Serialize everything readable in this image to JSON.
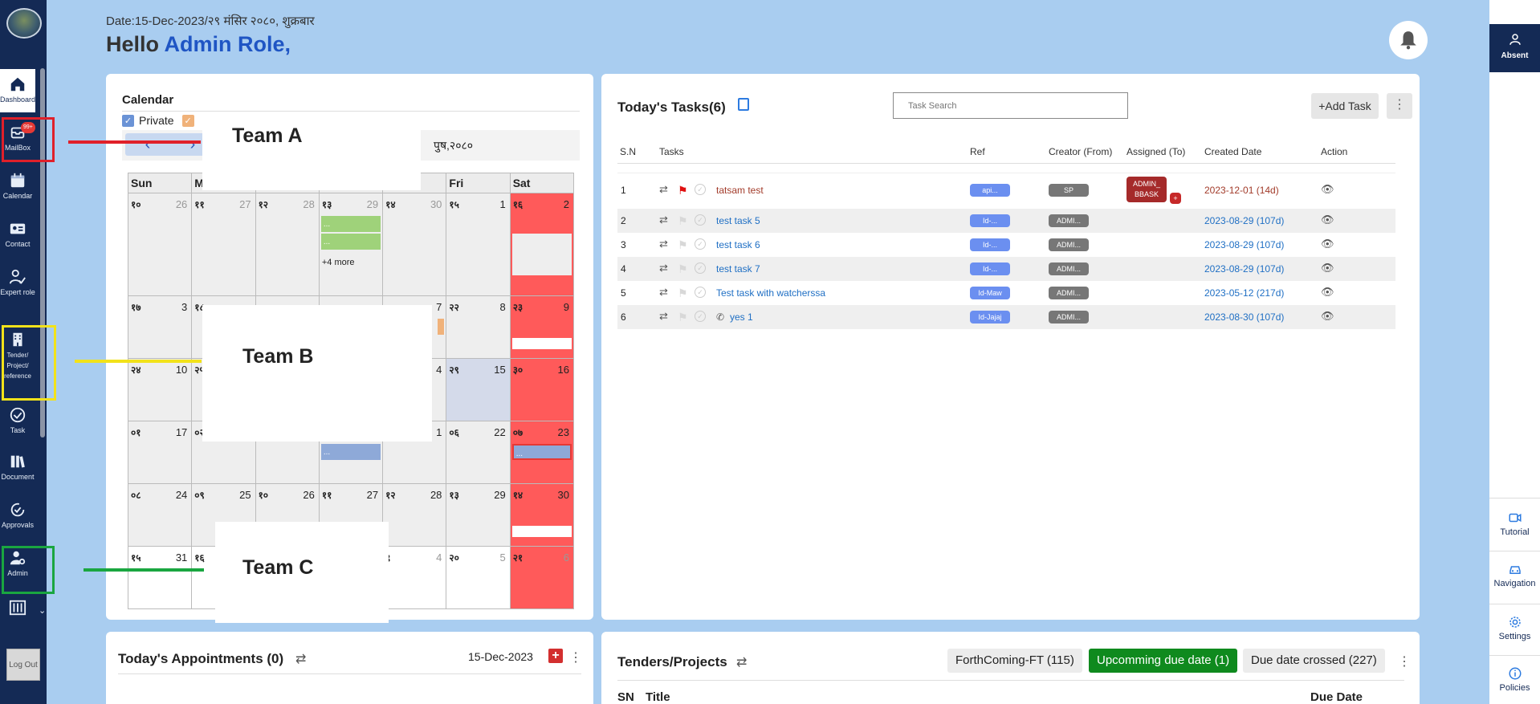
{
  "sidebar": {
    "items": [
      {
        "label": "Dashboard",
        "icon": "home-icon"
      },
      {
        "label": "MailBox",
        "icon": "mailbox-icon",
        "badge": "99+"
      },
      {
        "label": "Calendar",
        "icon": "calendar-icon"
      },
      {
        "label": "Contact",
        "icon": "contact-icon"
      },
      {
        "label": "Expert role",
        "icon": "expert-icon"
      },
      {
        "label": "Tender/ Project/ reference",
        "icon": "building-icon"
      },
      {
        "label": "Task",
        "icon": "check-icon"
      },
      {
        "label": "Document",
        "icon": "document-icon"
      },
      {
        "label": "Approvals",
        "icon": "approval-icon"
      },
      {
        "label": "Admin",
        "icon": "admin-icon"
      }
    ],
    "logout": "Log Out"
  },
  "header": {
    "date": "Date:15-Dec-2023/२९ मंसिर २०८०, शुक्रबार",
    "greeting_prefix": "Hello ",
    "greeting_name": "Admin Role,"
  },
  "teams": [
    "Team A",
    "Team B",
    "Team C"
  ],
  "team_colors": {
    "a": "#e0202a",
    "b": "#f2e21a",
    "c": "#1aa640"
  },
  "calendar": {
    "title": "Calendar",
    "legend_private": "Private",
    "month_label": "पुष,२०८०",
    "days": [
      "Sun",
      "M",
      "",
      "",
      "",
      "Fri",
      "Sat"
    ],
    "more": "+4 more",
    "weeks": [
      [
        {
          "n": "१०",
          "g": "26",
          "m": true
        },
        {
          "n": "११",
          "g": "27",
          "m": true
        },
        {
          "n": "१२",
          "g": "28",
          "m": true
        },
        {
          "n": "१३",
          "g": "29",
          "m": true
        },
        {
          "n": "१४",
          "g": "30",
          "m": true
        },
        {
          "n": "१५",
          "g": "1"
        },
        {
          "n": "१६",
          "g": "2",
          "red": true
        }
      ],
      [
        {
          "n": "१७",
          "g": "3"
        },
        {
          "n": "१८",
          "g": ""
        },
        {
          "n": "",
          "g": ""
        },
        {
          "n": "",
          "g": ""
        },
        {
          "n": "",
          "g": "7"
        },
        {
          "n": "२२",
          "g": "8"
        },
        {
          "n": "२३",
          "g": "9",
          "red": true
        }
      ],
      [
        {
          "n": "२४",
          "g": "10"
        },
        {
          "n": "२५",
          "g": ""
        },
        {
          "n": "",
          "g": ""
        },
        {
          "n": "",
          "g": ""
        },
        {
          "n": "",
          "g": "4"
        },
        {
          "n": "२९",
          "g": "15",
          "today": true
        },
        {
          "n": "३०",
          "g": "16",
          "red": true
        }
      ],
      [
        {
          "n": "०१",
          "g": "17"
        },
        {
          "n": "०२",
          "g": ""
        },
        {
          "n": "",
          "g": ""
        },
        {
          "n": "",
          "g": ""
        },
        {
          "n": "",
          "g": "1"
        },
        {
          "n": "०६",
          "g": "22"
        },
        {
          "n": "०७",
          "g": "23",
          "red": true
        }
      ],
      [
        {
          "n": "०८",
          "g": "24"
        },
        {
          "n": "०९",
          "g": "25"
        },
        {
          "n": "१०",
          "g": "26"
        },
        {
          "n": "११",
          "g": "27"
        },
        {
          "n": "१२",
          "g": "28"
        },
        {
          "n": "१३",
          "g": "29"
        },
        {
          "n": "१४",
          "g": "30",
          "red": true
        }
      ],
      [
        {
          "n": "१५",
          "g": "31",
          "white": true
        },
        {
          "n": "१६",
          "g": "",
          "white": true
        },
        {
          "n": "",
          "g": "",
          "white": true
        },
        {
          "n": "",
          "g": "",
          "white": true
        },
        {
          "n": "९",
          "g": "4",
          "m": true,
          "white": true
        },
        {
          "n": "२०",
          "g": "5",
          "m": true,
          "white": true
        },
        {
          "n": "२१",
          "g": "6",
          "m": true,
          "red": true
        }
      ]
    ]
  },
  "tasks": {
    "title": "Today's Tasks(6)",
    "search_placeholder": "Task Search",
    "add_label": "+Add Task",
    "columns": [
      "S.N",
      "Tasks",
      "Ref",
      "Creator (From)",
      "Assigned (To)",
      "Created Date",
      "Action"
    ],
    "rows": [
      {
        "sn": "1",
        "name": "tatsam test",
        "ref": "api...",
        "creator": "SP",
        "assigned": "ADMIN_ BBASK",
        "assigned_plus": "+",
        "date": "2023-12-01 (14d)",
        "overdue": true,
        "flag": true
      },
      {
        "sn": "2",
        "name": "test task 5",
        "ref": "Id-...",
        "creator": "ADMI...",
        "date": "2023-08-29 (107d)"
      },
      {
        "sn": "3",
        "name": "test task 6",
        "ref": "Id-...",
        "creator": "ADMI...",
        "date": "2023-08-29 (107d)"
      },
      {
        "sn": "4",
        "name": "test task 7",
        "ref": "Id-...",
        "creator": "ADMI...",
        "date": "2023-08-29 (107d)"
      },
      {
        "sn": "5",
        "name": "Test task with watcherssa",
        "ref": "Id-Maw",
        "creator": "ADMI...",
        "date": "2023-05-12 (217d)"
      },
      {
        "sn": "6",
        "name": "yes 1",
        "ref": "Id-Jajaj",
        "creator": "ADMI...",
        "date": "2023-08-30 (107d)",
        "phone": true
      }
    ]
  },
  "appointments": {
    "title": "Today's Appointments (0)",
    "date": "15-Dec-2023"
  },
  "projects": {
    "title": "Tenders/Projects",
    "forthcoming": "ForthComing-FT (115)",
    "upcoming": "Upcomming due date (1)",
    "crossed": "Due date crossed (227)",
    "col_sn": "SN",
    "col_title": "Title",
    "col_due": "Due Date"
  },
  "rail": {
    "absent": "Absent",
    "tutorial": "Tutorial",
    "navigation": "Navigation",
    "settings": "Settings",
    "policies": "Policies"
  }
}
